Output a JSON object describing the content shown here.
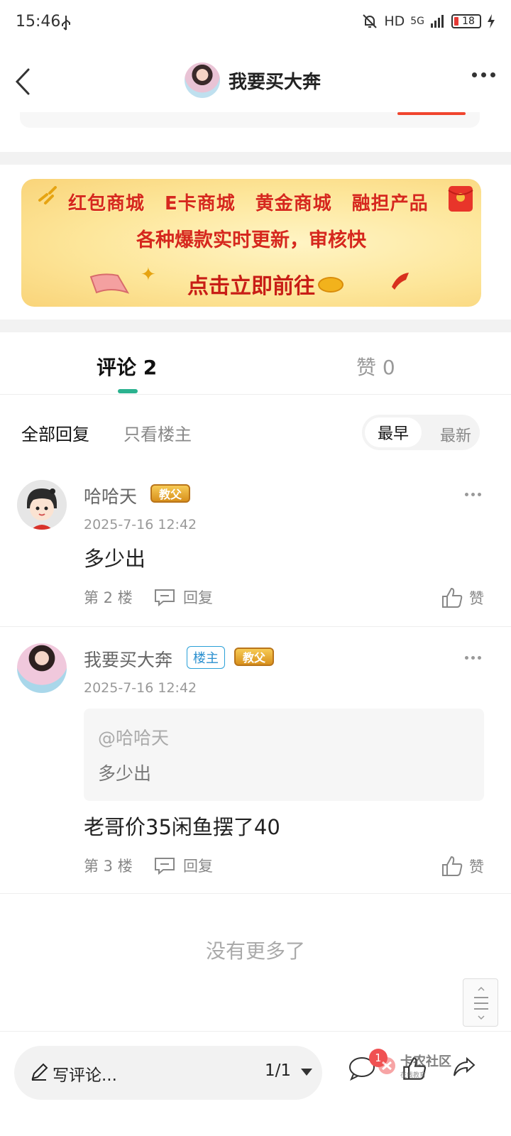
{
  "status_bar": {
    "time": "15:46",
    "network": "HD",
    "signal": "5G",
    "battery": "18"
  },
  "header": {
    "title": "我要买大奔"
  },
  "banner": {
    "row1": [
      "红包商城",
      "E卡商城",
      "黄金商城",
      "融担产品"
    ],
    "row2": "各种爆款实时更新，审核快",
    "row3": "点击立即前往"
  },
  "tabs": {
    "comments": "评论 2",
    "likes": "赞 0"
  },
  "filters": {
    "all": "全部回复",
    "owner_only": "只看楼主",
    "earliest": "最早",
    "latest": "最新"
  },
  "comments": [
    {
      "name": "哈哈天",
      "badge": "教父",
      "time": "2025-7-16 12:42",
      "text": "多少出",
      "floor": "第 2 楼",
      "reply": "回复",
      "like": "赞"
    },
    {
      "name": "我要买大奔",
      "owner_badge": "楼主",
      "badge": "教父",
      "time": "2025-7-16 12:42",
      "quote_at": "@哈哈天",
      "quote_text": "多少出",
      "text": "老哥价35闲鱼摆了40",
      "floor": "第 3 楼",
      "reply": "回复",
      "like": "赞"
    }
  ],
  "no_more": "没有更多了",
  "bottom_bar": {
    "write_label": "写评论...",
    "page": "1/1",
    "notif_count": "1",
    "watermark_title": "卡农社区",
    "watermark_sub": "在线教育"
  },
  "colors": {
    "accent": "#2bb28f",
    "banner_text": "#d6281e",
    "owner_badge": "#2a8fcf"
  }
}
